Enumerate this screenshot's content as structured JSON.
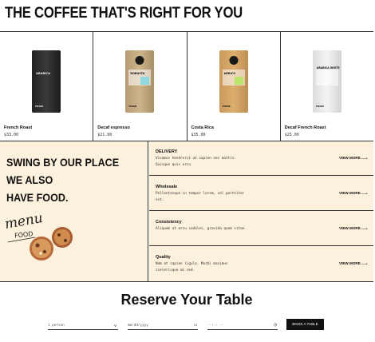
{
  "headline": "THE COFFEE THAT'S RIGHT FOR YOU",
  "products": [
    {
      "name": "French Roast",
      "price": "$33.00",
      "bag": "dark",
      "bag_text": "ARABICA",
      "bag_brand": "FROM",
      "swatch": ""
    },
    {
      "name": "Decaf espresso",
      "price": "$21.00",
      "bag": "kraft",
      "bag_text": "ROBUSTA",
      "bag_brand": "FROM",
      "swatch": "#8fd8e0"
    },
    {
      "name": "Costa Rica",
      "price": "$35.00",
      "bag": "orange",
      "bag_text": "ARRICO",
      "bag_brand": "FROM",
      "swatch": "#b9e66a"
    },
    {
      "name": "Decaf French Roast",
      "price": "$25.00",
      "bag": "white",
      "bag_text": "ARABICA WHITE",
      "bag_brand": "FROM",
      "swatch": ""
    }
  ],
  "food": {
    "title_line1": "SWING BY OUR PLACE WE ALSO",
    "title_line2": "HAVE FOOD.",
    "menu_word": "menu",
    "food_word": "FOOD"
  },
  "services": [
    {
      "title": "DELIVERY",
      "desc": "Vivamus hendrerit at sapien nec mattis. Quisque quis arcu",
      "link": "VIEW MORE"
    },
    {
      "title": "Wholesale",
      "desc": "Pellentesque in tempor lorem, vel porttitor est.",
      "link": "VIEW MORE"
    },
    {
      "title": "Consistency",
      "desc": "Aliquam ut arcu sodales, gravida quam vitae.",
      "link": "VIEW MORE"
    },
    {
      "title": "Quality",
      "desc": "Nam at sapien ligula. Morbi maximus scelerisque mi sed.",
      "link": "VIEW MORE"
    }
  ],
  "reserve": {
    "title": "Reserve Your Table",
    "persons_value": "1 person",
    "date_placeholder": "mm/dd/yyyy",
    "time_placeholder": "--:-- --",
    "button": "BOOK A TABLE"
  },
  "colors": {
    "cream": "#fcf1dc",
    "border": "#333333",
    "button": "#111111"
  }
}
